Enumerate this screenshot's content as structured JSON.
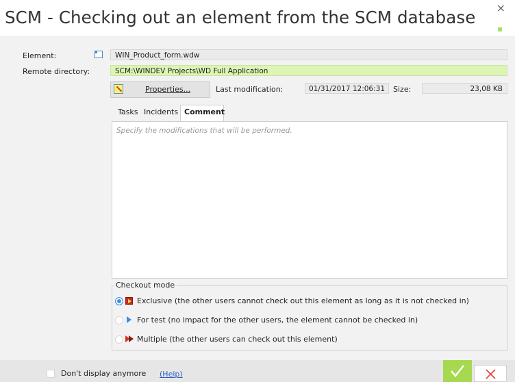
{
  "window": {
    "title": "SCM - Checking out an element from the SCM database",
    "close_glyph": "×"
  },
  "element": {
    "label": "Element:",
    "value": "WIN_Product_form.wdw",
    "icon": "document-icon"
  },
  "remote_directory": {
    "label": "Remote directory:",
    "value": "SCM:\\WINDEV Projects\\WD Full Application"
  },
  "properties_button": {
    "label": "Properties...",
    "icon": "properties-icon"
  },
  "last_modification": {
    "label": "Last modification:",
    "value": "01/31/2017 12:06:31"
  },
  "size": {
    "label": "Size:",
    "value": "23,08 KB"
  },
  "tabs": [
    {
      "label": "Tasks",
      "active": false
    },
    {
      "label": "Incidents",
      "active": false
    },
    {
      "label": "Comment",
      "active": true
    }
  ],
  "comment": {
    "placeholder": "Specify the modifications that will be performed."
  },
  "checkout_mode": {
    "legend": "Checkout mode",
    "options": [
      {
        "label": "Exclusive (the other users cannot check out this element as long as it is not checked in)",
        "selected": true,
        "icon": "exclusive-icon"
      },
      {
        "label": "For test (no impact for the other users, the element cannot be checked in)",
        "selected": false,
        "icon": "test-icon"
      },
      {
        "label": "Multiple (the other users can check out this element)",
        "selected": false,
        "icon": "multiple-icon"
      }
    ]
  },
  "footer": {
    "dont_display": "Don't display anymore",
    "dont_display_checked": false,
    "help_link": "(Help)"
  },
  "colors": {
    "accent_green": "#a6d94f",
    "remote_field_bg": "#dcf5b4",
    "radio_selected": "#3a8ee6",
    "cancel_red": "#e04a4a",
    "link_blue": "#2b5fc6"
  }
}
